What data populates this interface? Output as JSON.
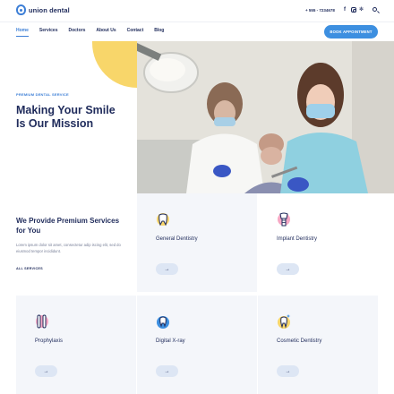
{
  "header": {
    "logo_text": "union dental",
    "phone": "+ 555 - 7234678",
    "social": [
      "facebook-icon",
      "instagram-icon",
      "yelp-icon"
    ],
    "cta_label": "BOOK APPOINTMENT"
  },
  "nav": {
    "items": [
      {
        "label": "Home",
        "active": true
      },
      {
        "label": "Services",
        "active": false
      },
      {
        "label": "Doctors",
        "active": false
      },
      {
        "label": "About Us",
        "active": false
      },
      {
        "label": "Contact",
        "active": false
      },
      {
        "label": "Blog",
        "active": false
      }
    ]
  },
  "hero": {
    "eyebrow": "PREMIUM DENTAL SERVICE",
    "title": "Making Your Smile Is Our Mission"
  },
  "services": {
    "intro_title": "We Provide Premium Services for You",
    "intro_text": "Lorem ipsum dolor sit amet, consectetur adip iscing elit, sed do eiusmod tempor incididunt.",
    "all_link": "ALL SERVICES",
    "items": [
      {
        "name": "General Dentistry",
        "icon": "tooth-icon"
      },
      {
        "name": "Implant Dentistry",
        "icon": "implant-icon"
      },
      {
        "name": "Prophylaxis",
        "icon": "toothbrush-icon"
      },
      {
        "name": "Digital X-ray",
        "icon": "xray-icon"
      },
      {
        "name": "Cosmetic Dentistry",
        "icon": "sparkle-tooth-icon"
      }
    ],
    "button_glyph": "→"
  },
  "colors": {
    "primary": "#3d7fd6",
    "navy": "#1f2b5b",
    "accent_yellow": "#f8d66a",
    "card_bg": "#f4f6fa"
  }
}
